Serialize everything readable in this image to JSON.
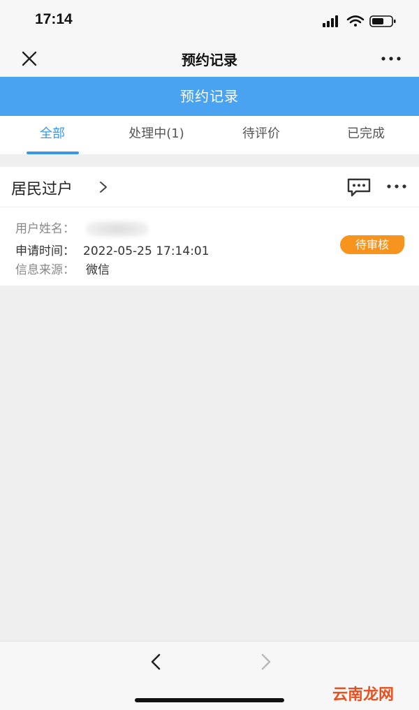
{
  "status_bar": {
    "time": "17:14"
  },
  "nav": {
    "title": "预约记录"
  },
  "header": {
    "title": "预约记录"
  },
  "tabs": [
    {
      "label": "全部",
      "active": true
    },
    {
      "label": "处理中(1)",
      "active": false
    },
    {
      "label": "待评价",
      "active": false
    },
    {
      "label": "已完成",
      "active": false
    }
  ],
  "record": {
    "title": "居民过户",
    "chevron": ">",
    "name_label": "用户姓名：",
    "time_label": "申请时间：",
    "time_value": "2022-05-25 17:14:01",
    "source_label": "信息来源：",
    "source_value": "微信",
    "status": "待审核"
  },
  "watermark": "云南龙网",
  "colors": {
    "accent": "#4aa3f0",
    "tab_active": "#3a97e8",
    "badge": "#f7941d"
  }
}
